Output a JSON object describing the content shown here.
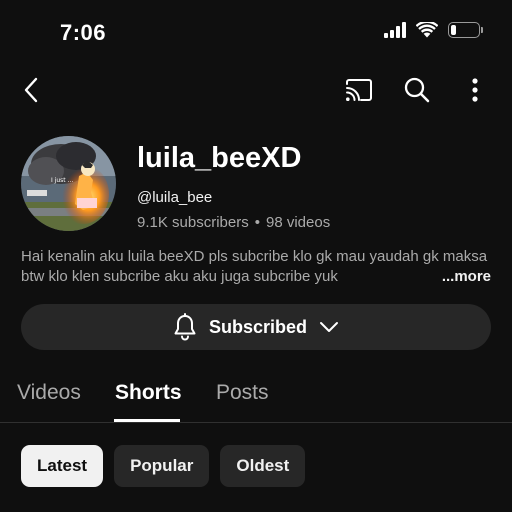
{
  "status_bar": {
    "time": "7:06",
    "battery_level": 0.2
  },
  "app_bar": {
    "icons": [
      "back-icon",
      "cast-icon",
      "search-icon",
      "more-vert-icon"
    ]
  },
  "channel": {
    "name": "luila_beeXD",
    "handle": "@luila_bee",
    "subscribers": "9.1K subscribers",
    "separator": "•",
    "videos": "98 videos",
    "avatar_caption": "I just ..."
  },
  "description": {
    "text": "Hai kenalin aku luila beeXD pls subcribe klo gk mau yaudah gk maksa btw klo klen subcribe aku aku juga subcribe yuk",
    "more_label": "...more"
  },
  "subscribe_button": {
    "label": "Subscribed",
    "icon": "bell-icon",
    "chevron": "chevron-down-icon"
  },
  "tabs": [
    {
      "label": "Videos",
      "active": false
    },
    {
      "label": "Shorts",
      "active": true
    },
    {
      "label": "Posts",
      "active": false
    }
  ],
  "filters": [
    {
      "label": "Latest",
      "selected": true
    },
    {
      "label": "Popular",
      "selected": false
    },
    {
      "label": "Oldest",
      "selected": false
    }
  ],
  "colors": {
    "background": "#0f0f0f",
    "surface": "#272727",
    "text_primary": "#f1f1f1",
    "text_secondary": "#aaaaaa"
  }
}
